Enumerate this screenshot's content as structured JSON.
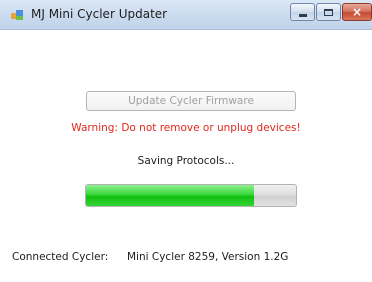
{
  "window": {
    "title": "MJ Mini Cycler Updater",
    "icon": "app-icon",
    "controls": {
      "minimize": "minimize-icon",
      "maximize": "maximize-icon",
      "close": "×"
    }
  },
  "main": {
    "update_button_label": "Update Cycler Firmware",
    "warning_text": "Warning: Do not remove or unplug devices!",
    "status_text": "Saving Protocols...",
    "progress_fraction": 0.8,
    "connected_label": "Connected Cycler:",
    "connected_value": "Mini Cycler 8259, Version 1.2G"
  },
  "colors": {
    "warning": "#e0281e",
    "progress": "#1fc91f",
    "titlebar": "#c9daee"
  }
}
